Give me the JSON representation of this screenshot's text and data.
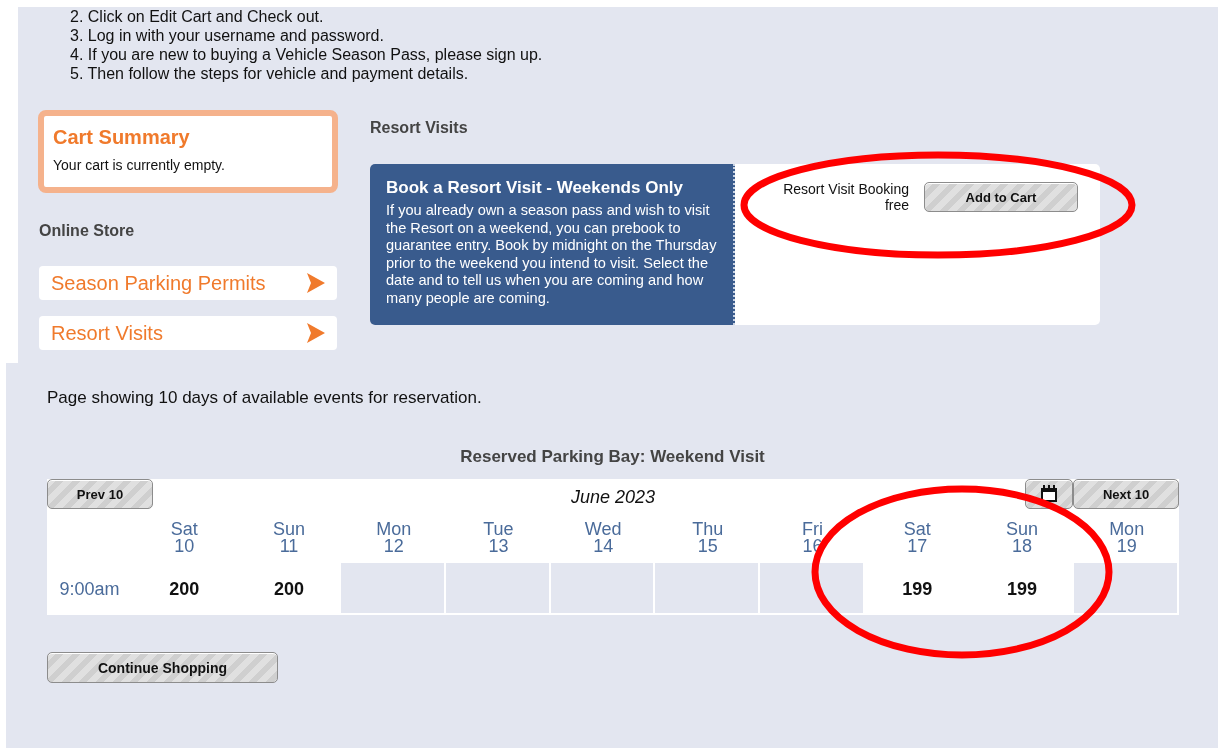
{
  "instructions": [
    "2. Click on Edit Cart and Check out.",
    "3. Log in with your username and password.",
    "4. If you are new to buying a Vehicle Season Pass, please sign up.",
    "5. Then follow the steps for vehicle and payment details."
  ],
  "cart": {
    "title": "Cart Summary",
    "message": "Your cart is currently empty."
  },
  "store": {
    "heading": "Online Store",
    "items": [
      {
        "label": "Season Parking Permits"
      },
      {
        "label": "Resort Visits"
      }
    ]
  },
  "product": {
    "heading": "Resort Visits",
    "title": "Book a Resort Visit - Weekends Only",
    "description": "If you already own a season pass and wish to visit the Resort on a weekend, you can prebook to guarantee entry. Book by midnight on the Thursday prior to the weekend you intend to visit. Select the date and to tell us when you are coming and how many people are coming.",
    "price_label": "Resort Visit Booking",
    "price": "free",
    "button": "Add to Cart"
  },
  "notice": "Page showing 10 days of available events for reservation.",
  "calendar": {
    "title": "Reserved Parking Bay: Weekend Visit",
    "prev": "Prev 10",
    "next": "Next 10",
    "month": "June 2023",
    "days": [
      {
        "day": "Sat",
        "date": "10"
      },
      {
        "day": "Sun",
        "date": "11"
      },
      {
        "day": "Mon",
        "date": "12"
      },
      {
        "day": "Tue",
        "date": "13"
      },
      {
        "day": "Wed",
        "date": "14"
      },
      {
        "day": "Thu",
        "date": "15"
      },
      {
        "day": "Fri",
        "date": "16"
      },
      {
        "day": "Sat",
        "date": "17"
      },
      {
        "day": "Sun",
        "date": "18"
      },
      {
        "day": "Mon",
        "date": "19"
      }
    ],
    "rows": [
      {
        "time": "9:00am",
        "cells": [
          {
            "available": true,
            "count": "200"
          },
          {
            "available": true,
            "count": "200"
          },
          {
            "available": false
          },
          {
            "available": false
          },
          {
            "available": false
          },
          {
            "available": false
          },
          {
            "available": false
          },
          {
            "available": true,
            "count": "199"
          },
          {
            "available": true,
            "count": "199"
          },
          {
            "available": false
          }
        ]
      }
    ]
  },
  "continue_button": "Continue Shopping"
}
